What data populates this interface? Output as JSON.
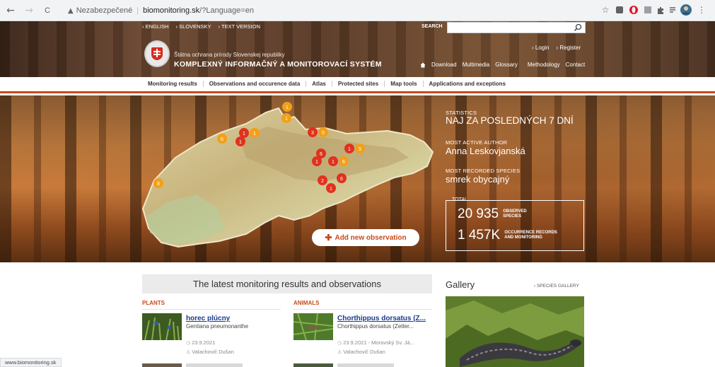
{
  "browser": {
    "back_icon": "←",
    "forward_icon": "→",
    "reload_icon": "C",
    "warning_icon": "▲",
    "security_text": "Nezabezpečené",
    "separator": "|",
    "host": "biomonitoring.sk",
    "path": "/?Language=en",
    "star_icon": "☆",
    "menu_icon": "⋮"
  },
  "site": {
    "toplinks": [
      "› ENGLISH",
      "› SLOVENSKY",
      "› TEXT VERSION"
    ],
    "search_label": "SEARCH",
    "search_placeholder": "",
    "org_name": "Štátna ochrana prírody Slovenskej republiky",
    "system_name": "KOMPLEXNÝ INFORMAČNÝ A MONITOROVACÍ SYSTÉM",
    "login": "› Login",
    "register": "› Register",
    "nav_links": [
      "Download",
      "Multimedia",
      "Glossary",
      "Methodology",
      "Contact"
    ],
    "menu": [
      "Monitoring results",
      "Observations and occurence data",
      "Atlas",
      "Protected sites",
      "Map tools",
      "Applications and exceptions"
    ],
    "add_observation": "Add new observation",
    "add_icon": "✚",
    "map_markers": [
      "1",
      "1",
      "1",
      "1",
      "1",
      "6",
      "3",
      "5",
      "1",
      "5",
      "6",
      "1",
      "1",
      "6",
      "2",
      "6",
      "1",
      "8"
    ]
  },
  "stats": {
    "statistics_label": "STATISTICS",
    "headline": "NAJ ZA POSLEDNÝCH 7 DNÍ",
    "most_active_label": "MOST ACTIVE AUTHOR",
    "most_active_value": "Anna Leskovjanská",
    "most_recorded_label": "MOST RECORDED SPECIES",
    "most_recorded_value": "smrek obycajný",
    "total_label": "TOTAL",
    "observed_num": "20 935",
    "observed_lbl1": "OBSERVED",
    "observed_lbl2": "SPECIES",
    "records_num": "1 457K",
    "records_lbl1": "OCCURRENCE RECORDS",
    "records_lbl2": "AND MONITORING"
  },
  "latest": {
    "heading": "The latest monitoring results and observations",
    "plants": {
      "heading": "PLANTS",
      "title": "horec plúcny",
      "latin": "Gentiana pneumonanthe",
      "date": "23.9.2021",
      "author": "Valachovič Dušan"
    },
    "animals": {
      "heading": "ANIMALS",
      "title": "Chorthippus dorsatus (Z...",
      "latin": "Chorthippus dorsatus (Zetter...",
      "date": "23.9.2021 - Moravský Sv. Já...",
      "author": "Valachovič Dušan"
    }
  },
  "gallery": {
    "title": "Gallery",
    "link": "› SPECIES GALLERY"
  },
  "statusbar": "www.biomonitoring.sk",
  "colors": {
    "accent": "#c74a1f",
    "link": "#1a3a8c",
    "marker_red": "#e0321e",
    "marker_orange": "#f2a019"
  }
}
